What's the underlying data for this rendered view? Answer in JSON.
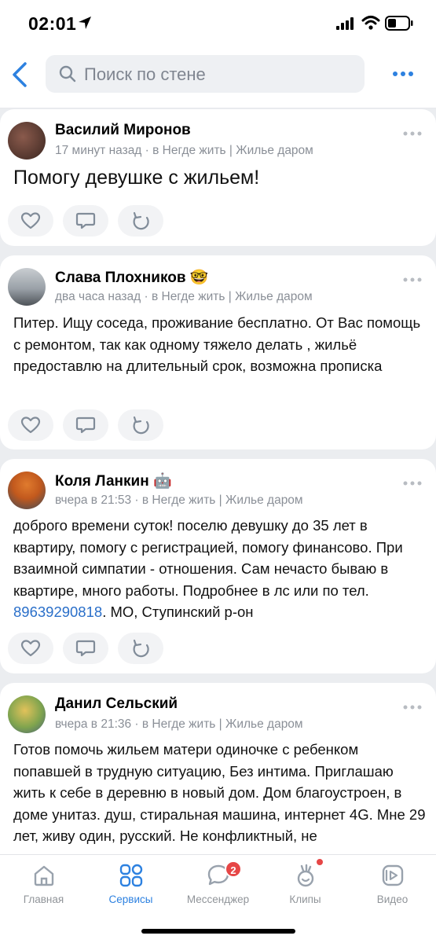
{
  "status_bar": {
    "time": "02:01"
  },
  "navbar": {
    "search_placeholder": "Поиск по стене"
  },
  "posts": [
    {
      "author": "Василий Миронов",
      "author_emoji": "",
      "meta": "17 минут назад · в Негде жить | Жилье даром",
      "text": "Помогу девушке с жильем!"
    },
    {
      "author": "Слава Плохников",
      "author_emoji": "🤓",
      "meta": "два часа назад · в Негде жить | Жилье даром",
      "text": "Питер. Ищу соседа, проживание бесплатно. От Вас помощь с ремонтом, так как одному тяжело делать , жильё предоставлю на длительный срок, возможна прописка"
    },
    {
      "author": "Коля Ланкин",
      "author_emoji": "🤖",
      "meta": "вчера в 21:53 · в Негде жить | Жилье даром",
      "text_before": "доброго времени суток! поселю девушку до 35 лет в квартиру, помогу с регистрацией, помогу финансово. При взаимной симпатии - отношения. Сам нечасто бываю в квартире, много работы. Подробнее в лс или по тел. ",
      "phone": "89639290818",
      "text_after": ". МО, Ступинский р-он"
    },
    {
      "author": "Данил Сельский",
      "author_emoji": "",
      "meta": "вчера в 21:36 · в Негде жить | Жилье даром",
      "text": "Готов помочь жильем матери одиночке с ребенком попавшей в трудную ситуацию, Без интима. Приглашаю жить к себе в деревню в новый дом. Дом благоустроен, в доме унитаз. душ, стиральная машина, интернет 4G. Мне 29 лет, живу один, русский. Не конфликтный, не"
    }
  ],
  "tabbar": {
    "tabs": [
      {
        "label": "Главная",
        "icon": "home-icon"
      },
      {
        "label": "Сервисы",
        "icon": "services-icon",
        "active": true
      },
      {
        "label": "Мессенджер",
        "icon": "messenger-icon",
        "badge": "2"
      },
      {
        "label": "Клипы",
        "icon": "clips-icon"
      },
      {
        "label": "Видео",
        "icon": "video-icon"
      }
    ]
  },
  "colors": {
    "accent": "#2d81e0",
    "link": "#2a6fc9",
    "badge": "#e64646",
    "background": "#ebedf0"
  }
}
